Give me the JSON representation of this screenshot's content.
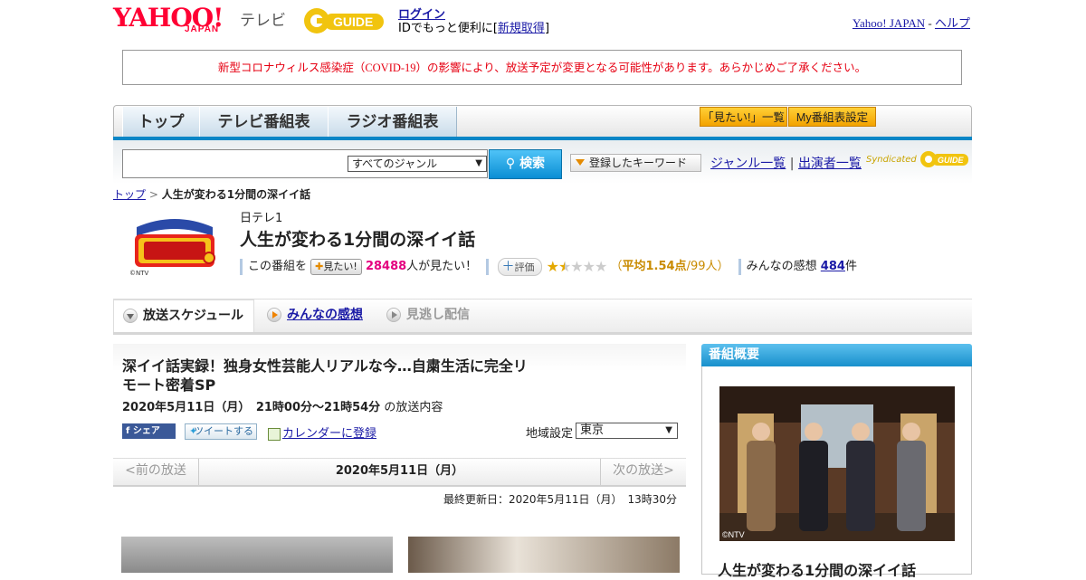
{
  "header": {
    "yahoo_logo": "YAHOO!",
    "japan_label": "JAPAN",
    "tv_label": "テレビ",
    "gguide_logo": "G GUIDE",
    "login_label": "ログイン",
    "id_text_prefix": "IDでもっと便利に[",
    "signup_label": "新規取得",
    "id_text_suffix": "]",
    "yahoo_japan_link": "Yahoo! JAPAN",
    "separator": "-",
    "help_link": "ヘルプ"
  },
  "notice": "新型コロナウィルス感染症（COVID-19）の影響により、放送予定が変更となる可能性があります。あらかじめご了承ください。",
  "nav": {
    "tabs": [
      "トップ",
      "テレビ番組表",
      "ラジオ番組表"
    ],
    "mitai_list": "「見たい!」一覧",
    "my_settings": "My番組表設定"
  },
  "search": {
    "input_value": "",
    "genre_selected": "すべてのジャンル",
    "button_label": "検索",
    "keyword_button": "登録したキーワード",
    "genre_list_link": "ジャンル一覧",
    "divider": "|",
    "cast_list_link": "出演者一覧",
    "syndicated": "Syndicated"
  },
  "breadcrumb": {
    "top": "トップ",
    "sep": ">",
    "current": "人生が変わる1分間の深イイ話"
  },
  "program": {
    "thumb_credit": "©NTV",
    "channel": "日テレ1",
    "title": "人生が変わる1分間の深イイ話",
    "this_program": "この番組を",
    "mitai_badge": "見たい!",
    "mitai_count": "28488",
    "mitai_suffix": "人が見たい！",
    "rating_badge": "評価",
    "rating_avg_prefix": "（",
    "rating_avg": "平均1.54点",
    "rating_count": "/99人）",
    "rating_value": 1.54,
    "impressions_label": "みんなの感想",
    "impressions_count": "484",
    "impressions_suffix": "件"
  },
  "tabs": {
    "schedule": "放送スケジュール",
    "impressions": "みんなの感想",
    "missed": "見逃し配信"
  },
  "episode": {
    "title": "深イイ話実録！独身女性芸能人リアルな今…自粛生活に完全リモート密着SP",
    "date": "2020年5月11日（月）　21時00分～21時54分",
    "date_suffix": "の放送内容",
    "share_fb": "シェア",
    "share_tw": "ツイートする",
    "calendar": "カレンダーに登録",
    "region_label": "地域設定",
    "region_value": "東京"
  },
  "pager": {
    "prev": "<前の放送",
    "date": "2020年5月11日（月）",
    "next": "次の放送>"
  },
  "updated": "最終更新日：2020年5月11日（月）　13時30分",
  "overview": {
    "heading": "番組概要",
    "photo_credit": "©NTV",
    "title": "人生が変わる1分間の深イイ話"
  },
  "colors": {
    "yahoo_red": "#ff0033",
    "notice_red": "#e60012",
    "nav_blue": "#0a86c6",
    "pink": "#e4007f",
    "star_gold": "#e4a800"
  }
}
